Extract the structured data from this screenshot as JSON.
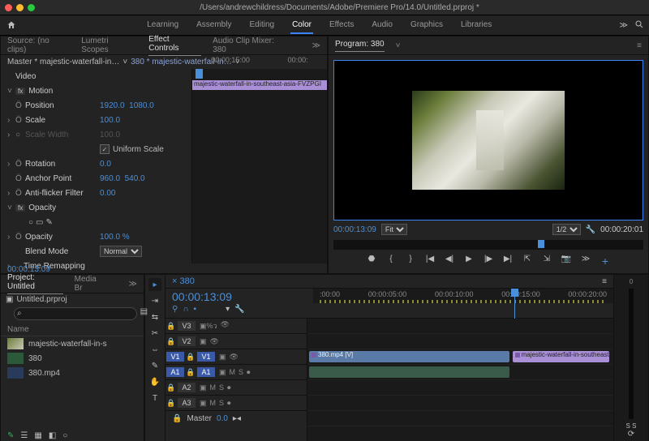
{
  "titlebar": {
    "path": "/Users/andrewchildress/Documents/Adobe/Premiere Pro/14.0/Untitled.prproj *"
  },
  "workspaces": {
    "items": [
      "Learning",
      "Assembly",
      "Editing",
      "Color",
      "Effects",
      "Audio",
      "Graphics",
      "Libraries"
    ],
    "active": "Color"
  },
  "source_panel": {
    "tabs": [
      "Source: (no clips)",
      "Lumetri Scopes",
      "Effect Controls",
      "Audio Clip Mixer: 380"
    ],
    "active": "Effect Controls",
    "master": "Master * majestic-waterfall-in…",
    "clip_sel": "380 * majestic-waterfall-in…",
    "mini_times": [
      "00:00:15:00",
      "00:00:"
    ],
    "mini_clip": "majestic-waterfall-in-southeast-asia-FVZPGI",
    "sections": {
      "video": "Video",
      "motion": "Motion",
      "position": {
        "label": "Position",
        "x": "1920.0",
        "y": "1080.0"
      },
      "scale": {
        "label": "Scale",
        "v": "100.0"
      },
      "scalew": {
        "label": "Scale Width",
        "v": "100.0"
      },
      "uniform": "Uniform Scale",
      "rotation": {
        "label": "Rotation",
        "v": "0.0"
      },
      "anchor": {
        "label": "Anchor Point",
        "x": "960.0",
        "y": "540.0"
      },
      "flicker": {
        "label": "Anti-flicker Filter",
        "v": "0.00"
      },
      "opacity_hdr": "Opacity",
      "opacity": {
        "label": "Opacity",
        "v": "100.0 %"
      },
      "blend": {
        "label": "Blend Mode",
        "v": "Normal"
      },
      "timeremap": "Time Remapping"
    },
    "bottom_tc": "00:00:13:09"
  },
  "program": {
    "tab": "Program: 380",
    "tc": "00:00:13:09",
    "zoom": "Fit",
    "res": "1/2",
    "duration": "00:00:20:01"
  },
  "project": {
    "tabs": [
      "Project: Untitled",
      "Media Br"
    ],
    "file": "Untitled.prproj",
    "search_placeholder": "",
    "col": "Name",
    "items": [
      {
        "name": "majestic-waterfall-in-s",
        "thumb": "v"
      },
      {
        "name": "380",
        "thumb": "s"
      },
      {
        "name": "380.mp4",
        "thumb": "m"
      }
    ]
  },
  "timeline": {
    "seq": "380",
    "tc": "00:00:13:09",
    "ruler": [
      ":00:00",
      "00:00:05:00",
      "00:00:10:00",
      "00:00:15:00",
      "00:00:20:00"
    ],
    "tracks": {
      "v3": "V3",
      "v2": "V2",
      "v1": "V1",
      "a1": "A1",
      "a2": "A2",
      "a3": "A3",
      "v1_src": "V1",
      "a1_src": "A1"
    },
    "clip_video": "380.mp4 [V]",
    "clip_video2": "majestic-waterfall-in-southeast-asia-F",
    "master": "Master",
    "master_val": "0.0"
  },
  "mixer": {
    "meter_labels": "S   S"
  }
}
